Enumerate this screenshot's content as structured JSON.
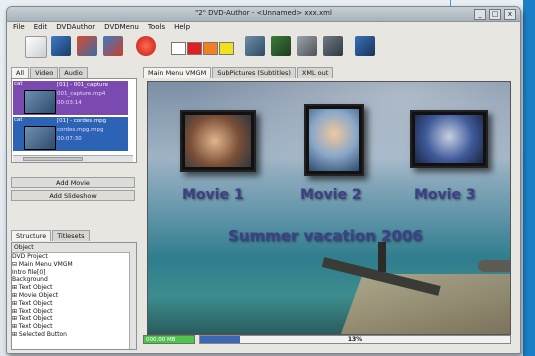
{
  "window": {
    "title": "\"2\" DVD-Author - <Unnamed> xxx.xml",
    "min": "_",
    "max": "□",
    "close": "x"
  },
  "menu": [
    "File",
    "Edit",
    "DVDAuthor",
    "DVDMenu",
    "Tools",
    "Help"
  ],
  "toolbar": {
    "icons": [
      "new-icon",
      "open-icon",
      "save-icon",
      "import-icon",
      "burn-icon",
      "palette-white",
      "palette-red",
      "palette-orange",
      "palette-yellow",
      "add-file-icon",
      "add-video-icon",
      "add-audio-icon",
      "add-subtitle-icon",
      "settings-icon"
    ],
    "swatch_colors": [
      "#ffffff",
      "#e02020",
      "#f08020",
      "#f0e020"
    ]
  },
  "left": {
    "tabs": [
      "All",
      "Video",
      "Audio"
    ],
    "files": [
      {
        "short": "cat",
        "line1": "[01] - 001_capture",
        "line2": "001_capture.mp4",
        "line3": "00:03:14"
      },
      {
        "short": "cat",
        "line1": "[01] - cordes.mpg",
        "line2": "cordes.mpg.mpg",
        "line3": "00:07:30"
      }
    ],
    "add_movie": "Add Movie",
    "add_slideshow": "Add Slideshow",
    "tree_tabs": [
      "Structure",
      "Titlesets"
    ],
    "tree_header": "Object",
    "tree": [
      "DVD Project",
      "⊟ Main Menu VMGM",
      "    Intro file[0]",
      "    Background",
      "  ⊞ Text Object",
      "  ⊞ Movie Object",
      "  ⊞ Text Object",
      "  ⊞ Text Object",
      "  ⊞ Text Object",
      "  ⊞ Text Object",
      "  ⊞ Selected Button"
    ]
  },
  "right": {
    "tabs": [
      "Main Menu VMGM",
      "SubPictures (Subtitles)",
      "XML out"
    ],
    "movies": [
      "Movie 1",
      "Movie 2",
      "Movie 3"
    ],
    "caption": "Summer vacation 2006"
  },
  "status": {
    "size": "000.00 MB",
    "progress_label": "13%",
    "progress": 0.13
  }
}
